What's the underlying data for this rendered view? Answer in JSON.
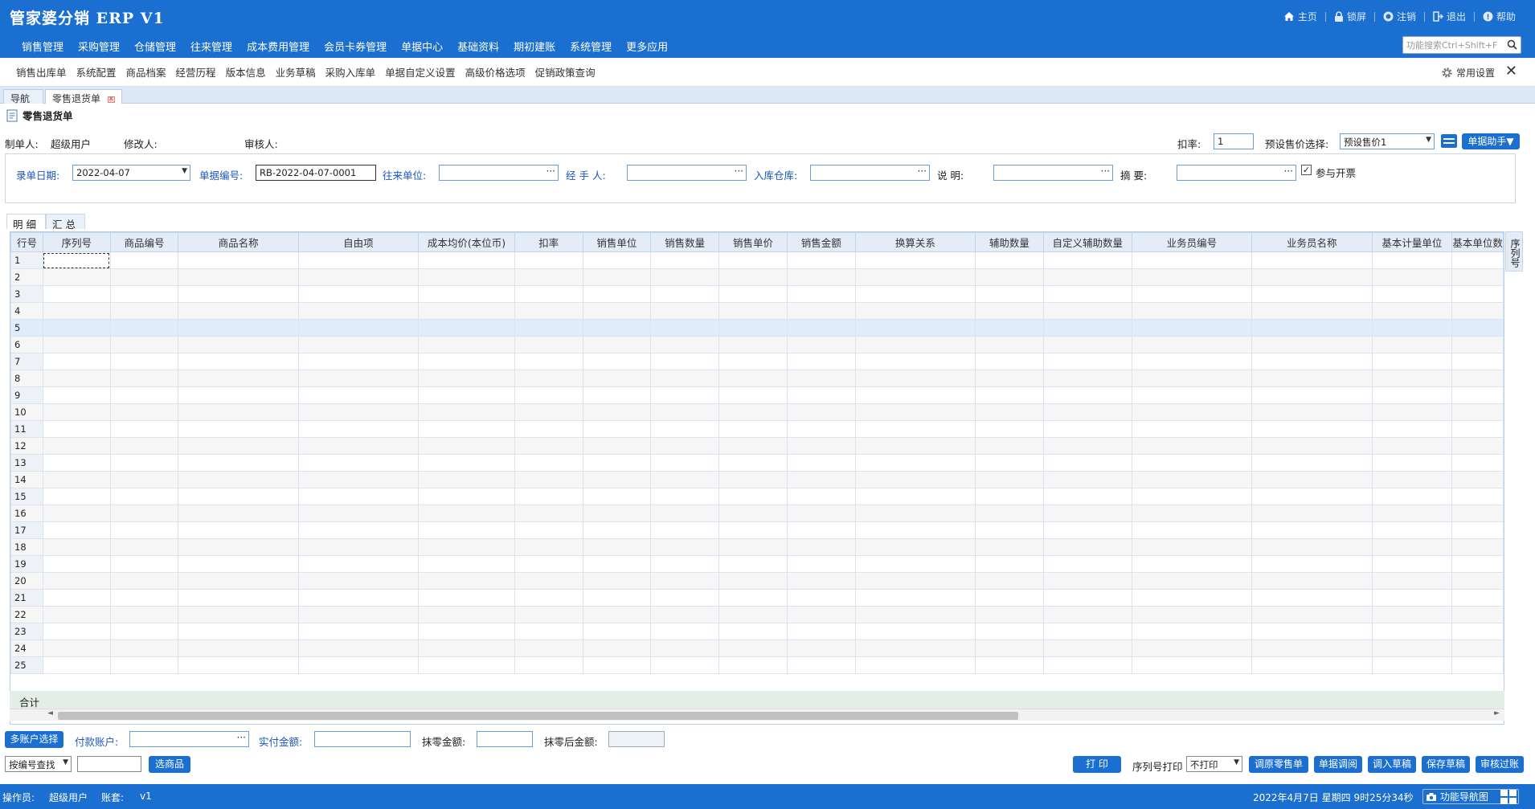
{
  "app": {
    "title": "管家婆分销 ERP V1"
  },
  "top_actions": [
    {
      "icon": "home-icon",
      "label": "主页"
    },
    {
      "icon": "lock-icon",
      "label": "锁屏"
    },
    {
      "icon": "logout-circle-icon",
      "label": "注销"
    },
    {
      "icon": "exit-icon",
      "label": "退出"
    },
    {
      "icon": "help-icon",
      "label": "帮助"
    }
  ],
  "main_menu": [
    "销售管理",
    "采购管理",
    "仓储管理",
    "往来管理",
    "成本费用管理",
    "会员卡券管理",
    "单据中心",
    "基础资料",
    "期初建账",
    "系统管理",
    "更多应用"
  ],
  "search": {
    "placeholder": "功能搜索Ctrl+Shift+F"
  },
  "sub_menu": [
    "销售出库单",
    "系统配置",
    "商品档案",
    "经营历程",
    "版本信息",
    "业务草稿",
    "采购入库单",
    "单据自定义设置",
    "高级价格选项",
    "促销政策查询"
  ],
  "common_settings": "常用设置",
  "tabs": [
    {
      "label": "导航"
    },
    {
      "label": "零售退货单"
    }
  ],
  "form": {
    "title": "零售退货单"
  },
  "meta": {
    "creator_label": "制单人:",
    "creator": "超级用户",
    "modifier_label": "修改人:",
    "reviewer_label": "审核人:",
    "discount_label": "扣率:",
    "discount": "1",
    "preset_label": "预设售价选择:",
    "preset_value": "预设售价1",
    "helper_btn": "单据助手▼"
  },
  "filters": {
    "date_label": "录单日期:",
    "date": "2022-04-07",
    "number_label": "单据编号:",
    "number": "RB-2022-04-07-0001",
    "partner_label": "往来单位:",
    "handler_label": "经 手 人:",
    "warehouse_label": "入库仓库:",
    "note_label": "说    明:",
    "summary_label": "摘    要:",
    "invoice_label": "参与开票",
    "invoice_checked": true
  },
  "grid_tabs": [
    "明细",
    "汇总"
  ],
  "grid": {
    "headers": [
      "行号",
      "序列号",
      "商品编号",
      "商品名称",
      "自由项",
      "成本均价(本位币)",
      "扣率",
      "销售单位",
      "销售数量",
      "销售单价",
      "销售金额",
      "换算关系",
      "辅助数量",
      "自定义辅助数量",
      "业务员编号",
      "业务员名称",
      "基本计量单位",
      "基本单位数"
    ],
    "rows": [
      "1",
      "2",
      "3",
      "4",
      "5",
      "6",
      "7",
      "8",
      "9",
      "10",
      "11",
      "12",
      "13",
      "14",
      "15",
      "16",
      "17",
      "18",
      "19",
      "20",
      "21",
      "22",
      "23",
      "24",
      "25"
    ],
    "side_header": "序列号",
    "total_label": "合计"
  },
  "payment": {
    "multi_btn": "多账户选择",
    "account_label": "付款账户:",
    "paid_label": "实付金额:",
    "rounding_label": "抹零金额:",
    "after_label": "抹零后金额:"
  },
  "bottom": {
    "lookup_select": "按编号查找",
    "select_goods_btn": "选商品",
    "print_btn": "打 印",
    "serial_print_label": "序列号打印",
    "serial_print_value": "不打印",
    "buttons": [
      "调原零售单",
      "单据调阅",
      "调入草稿",
      "保存草稿",
      "审核过账"
    ]
  },
  "status": {
    "operator_label": "操作员:",
    "operator": "超级用户",
    "account_label": "账套:",
    "account": "v1",
    "datetime": "2022年4月7日 星期四 9时25分34秒",
    "nav_map": "功能导航图"
  }
}
